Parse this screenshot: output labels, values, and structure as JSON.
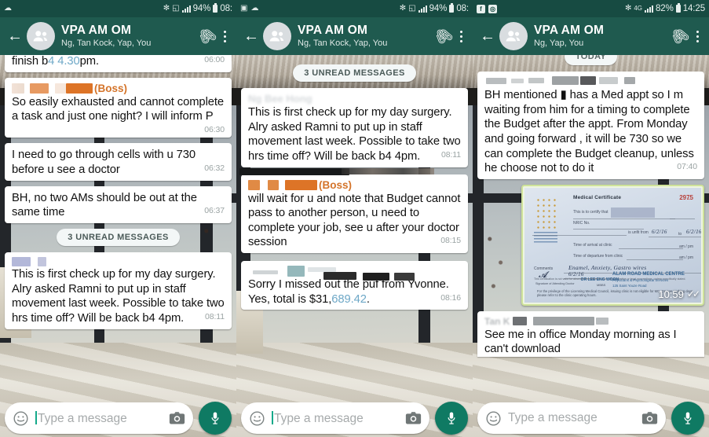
{
  "panels": [
    {
      "status": {
        "left_icons": [
          "weather-icon"
        ],
        "bluetooth": "bluetooth-icon",
        "wifi": "wifi-icon",
        "signal": "signal-icon",
        "battery_pct": "94%",
        "time": "08:"
      },
      "header": {
        "title": "VPA AM OM",
        "subtitle": "Ng, Tan Kock, Yap, You",
        "back": "back-arrow",
        "attach": "paperclip-icon",
        "menu": "overflow-menu"
      },
      "messages": [
        {
          "type": "text",
          "partial_top": true,
          "text_pre": "finish b",
          "text_hl": "4 4.30",
          "text_post": "pm.",
          "time": "06:00"
        },
        {
          "type": "text",
          "sender_redacted": true,
          "sender_tag": "(Boss)",
          "text": "So easily exhausted and cannot complete a task and just one night? I will inform P",
          "time": "06:30"
        },
        {
          "type": "text",
          "text": "I need to go through cells with u 730 before u see a doctor",
          "time": "06:32"
        },
        {
          "type": "text",
          "text": "BH, no two AMs should be out at the same time",
          "time": "06:37"
        },
        {
          "type": "divider",
          "label": "3 UNREAD MESSAGES"
        },
        {
          "type": "text",
          "sender_redacted": true,
          "text": "This is first check up for my day surgery. Alry asked Ramni to put up in staff movement last week. Possible to take two hrs time off? Will be back b4 4pm.",
          "time": "08:11"
        }
      ],
      "composer": {
        "placeholder": "Type a message",
        "emoji": "smiley-icon",
        "camera": "camera-icon",
        "mic": "microphone-icon",
        "has_caret": true
      }
    },
    {
      "status": {
        "left_icons": [
          "screenshot-icon",
          "weather-icon"
        ],
        "battery_pct": "94%",
        "time": "08:"
      },
      "header": {
        "title": "VPA AM OM",
        "subtitle": "Ng, Tan Kock, Yap, You",
        "back": "back-arrow",
        "attach": "paperclip-icon",
        "menu": "overflow-menu"
      },
      "messages": [
        {
          "type": "divider",
          "label": "3 UNREAD MESSAGES"
        },
        {
          "type": "text",
          "sender_redacted": true,
          "sender_faint": "Ng Bee Hong",
          "text": "This is first check up for my day surgery. Alry asked Ramni to put up in staff movement last week. Possible to take two hrs time off? Will be back b4 4pm.",
          "time": "08:11"
        },
        {
          "type": "text",
          "sender_redacted": true,
          "sender_tag": "(Boss)",
          "text": "     will wait for u and note that Budget cannot pass to another person, u need to complete your job, see u after your doctor session",
          "time": "08:15"
        },
        {
          "type": "text",
          "sender_redacted": true,
          "text_pre": "Sorry I missed out the puf from Yvonne. Yes, total is $31,",
          "text_hl": "689.42",
          "text_post": ".",
          "time": "08:16"
        }
      ],
      "composer": {
        "placeholder": "Type a message",
        "emoji": "smiley-icon",
        "camera": "camera-icon",
        "mic": "microphone-icon",
        "has_caret": true
      }
    },
    {
      "status": {
        "left_icons": [
          "facebook-icon",
          "instagram-icon"
        ],
        "network": "4G",
        "battery_pct": "82%",
        "time": "14:25"
      },
      "header": {
        "title": "VPA AM OM",
        "subtitle": "Ng, Yap, You",
        "back": "back-arrow",
        "attach": "paperclip-icon",
        "menu": "overflow-menu"
      },
      "messages": [
        {
          "type": "divider",
          "label": "TODAY"
        },
        {
          "type": "text",
          "sender_redacted": true,
          "text": "BH mentioned ▮  has a Med appt so I m waiting from him for a timing to complete the Budget after the appt. From Monday and going forward , it will be 730 so we can complete the Budget cleanup, unless he choose not to do it",
          "time": "07:40"
        },
        {
          "type": "image",
          "time": "10:59",
          "ticks": "✓✓",
          "certificate": {
            "title": "Medical Certificate",
            "number": "2975",
            "clinic": "ALAM ROAD MEDICAL CENTRE",
            "doctor": "DR LEE ENG WOON",
            "handwriting_date": "6/2/16",
            "handwriting_to": "6/2/16",
            "comments": "Enamel, Anxiety, Gastro wires",
            "dept": "Physicians & Psychological Services",
            "address": "125 Saint Youze Road"
          }
        },
        {
          "type": "text",
          "sender_redacted": true,
          "text": "See me in office Monday morning as I can't download",
          "partial_bottom": true
        }
      ],
      "composer": {
        "placeholder": "Type a message",
        "emoji": "smiley-icon",
        "camera": "camera-icon",
        "mic": "microphone-icon",
        "has_caret": false
      }
    }
  ],
  "colors": {
    "appbar": "#1f5a4f",
    "statusbar": "#174b42",
    "accent_green": "#0f7a63",
    "boss_orange": "#d4742a",
    "link_blue": "#6ea8c7"
  }
}
